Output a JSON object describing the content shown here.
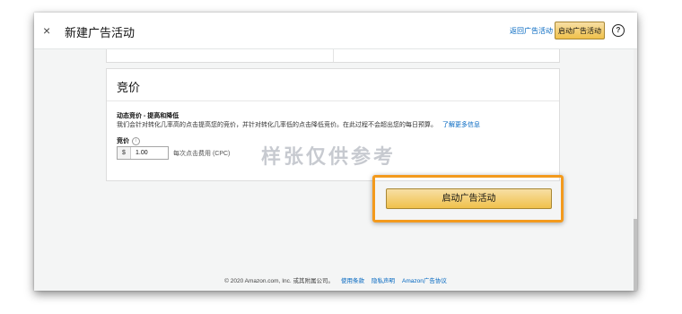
{
  "header": {
    "close_glyph": "×",
    "title": "新建广告活动",
    "return_link": "返回广告活动",
    "launch_button": "启动广告活动",
    "help_glyph": "?"
  },
  "bidding_section": {
    "title": "竞价",
    "strategy_label": "动态竞价 - 提高和降低",
    "strategy_desc": "我们会针对转化几率高的点击提高您的竞价，并针对转化几率低的点击降低竞价。在此过程不会超出您的每日预算。",
    "learn_more": "了解更多信息",
    "bid_label": "竞价",
    "info_glyph": "i",
    "currency": "$",
    "bid_value": "1.00",
    "cpc_label": "每次点击费用 (CPC)"
  },
  "watermark": "样张仅供参考",
  "launch_main_button": "启动广告活动",
  "footer": {
    "copyright": "© 2020 Amazon.com, Inc. 或其附属公司。",
    "links": [
      "使用条款",
      "隐私声明",
      "Amazon广告协议"
    ]
  },
  "colors": {
    "accent_button": "#f0c14b",
    "highlight_border": "#f39a1d",
    "link": "#0066c0"
  },
  "icons": [
    "close-icon",
    "help-icon",
    "info-icon"
  ]
}
